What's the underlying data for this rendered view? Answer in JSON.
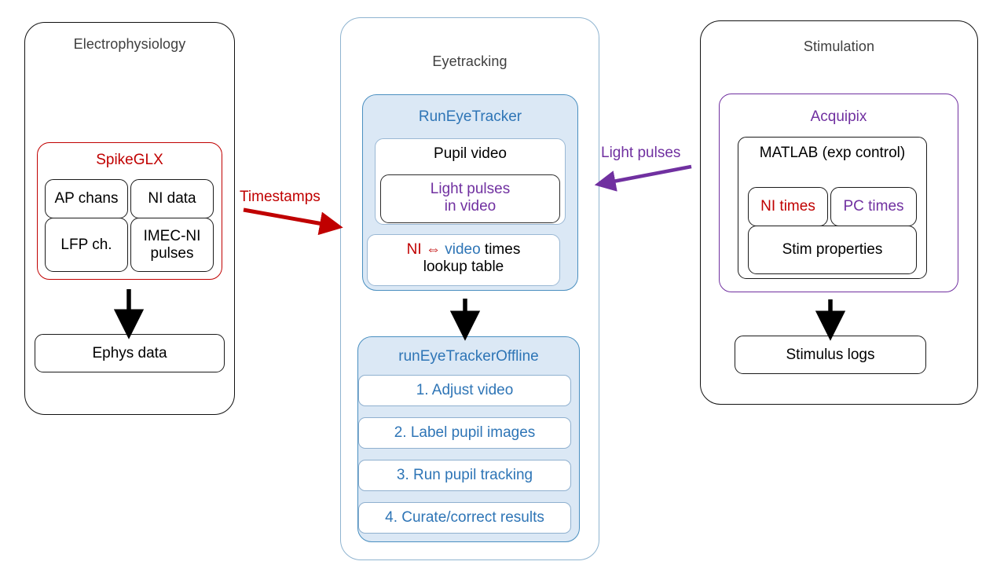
{
  "diagram": {
    "title_color_default": "#3f3f3f",
    "colors": {
      "red": "#c00000",
      "purple": "#7030a0",
      "blue": "#2e75b6",
      "light_blue_fill": "#dbe8f5",
      "black": "#000000"
    }
  },
  "panels": {
    "electrophysiology": {
      "title": "Electrophysiology",
      "spikeglx": {
        "title": "SpikeGLX",
        "cells": [
          "AP chans",
          "NI data",
          "LFP ch.",
          "IMEC-NI pulses"
        ]
      },
      "output_box": "Ephys data"
    },
    "eyetracking": {
      "title": "Eyetracking",
      "run_eye_tracker": {
        "title": "RunEyeTracker",
        "pupil_video_label": "Pupil video",
        "light_pulses_line1": "Light pulses",
        "light_pulses_line2": "in video",
        "lookup_part_ni": "NI",
        "lookup_part_arrow": "⇔",
        "lookup_part_video": "video",
        "lookup_part_times": "times",
        "lookup_line2": "lookup table"
      },
      "offline": {
        "title": "runEyeTrackerOffline",
        "steps": [
          "1. Adjust video",
          "2. Label pupil images",
          "3. Run pupil tracking",
          "4. Curate/correct results"
        ]
      }
    },
    "stimulation": {
      "title": "Stimulation",
      "acquipix": {
        "title": "Acquipix",
        "matlab_label": "MATLAB (exp control)",
        "ni_times": "NI times",
        "pc_times": "PC times",
        "stim_properties": "Stim properties"
      },
      "output_box": "Stimulus logs"
    }
  },
  "connectors": {
    "timestamps_label": "Timestamps",
    "light_pulses_label": "Light pulses"
  }
}
